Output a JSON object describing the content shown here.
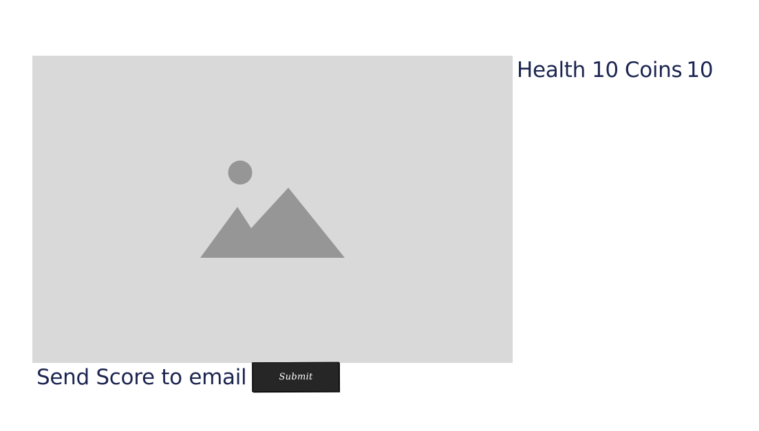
{
  "stats": {
    "health_label": "Health",
    "health_value": "10",
    "coins_label": "Coins",
    "coins_value": "10"
  },
  "footer": {
    "send_label": "Send Score to email",
    "submit_label": "Submit"
  },
  "image": {
    "icon": "image-placeholder-icon",
    "background_color": "#d9d9d9",
    "icon_color": "#969696"
  },
  "colors": {
    "text": "#1c2550",
    "button_bg": "#262626",
    "button_text": "#ffffff"
  }
}
